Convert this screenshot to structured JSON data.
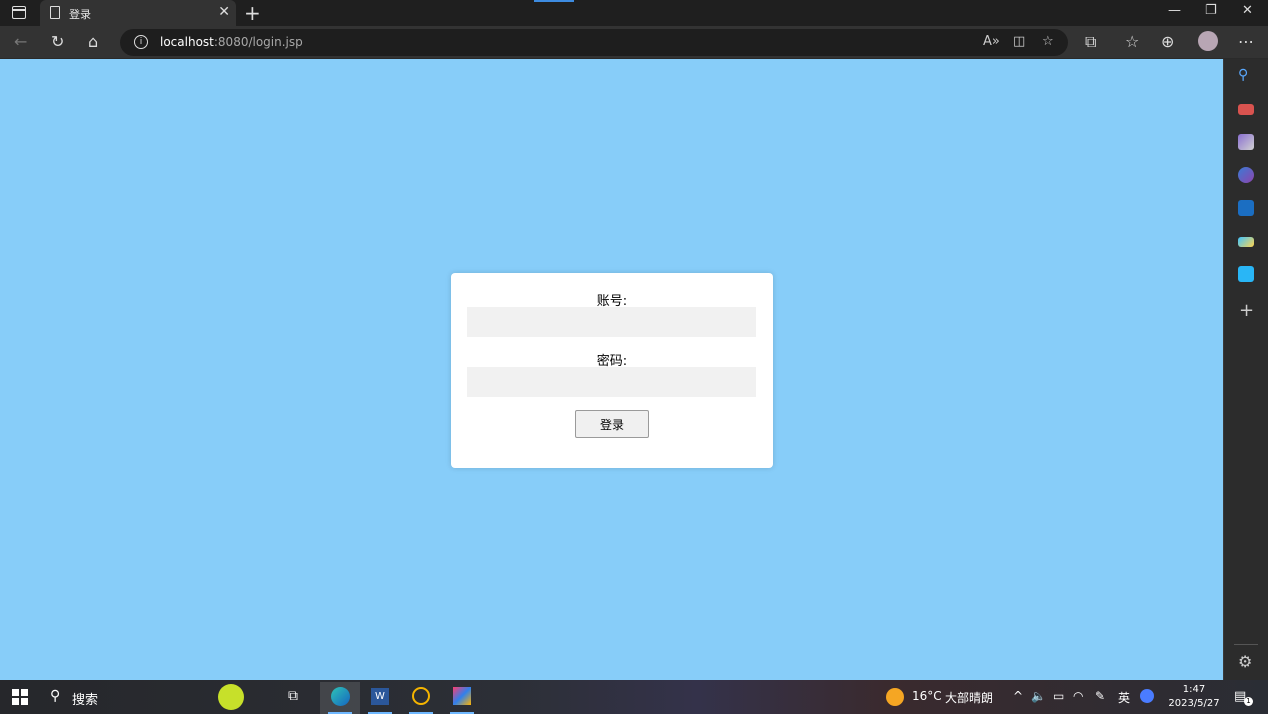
{
  "browser": {
    "tab_title": "登录",
    "url_host": "localhost",
    "url_rest": ":8080/login.jsp"
  },
  "login": {
    "account_label": "账号:",
    "account_value": "",
    "password_label": "密码:",
    "password_value": "",
    "submit_label": "登录"
  },
  "taskbar": {
    "search_text": "搜索",
    "weather_temp": "16°C",
    "weather_desc": "大部晴朗",
    "ime": "英",
    "time": "1:47",
    "date": "2023/5/27",
    "notification_count": "1"
  },
  "colors": {
    "page_background": "#87cdf9",
    "accent": "#3d8be0"
  }
}
